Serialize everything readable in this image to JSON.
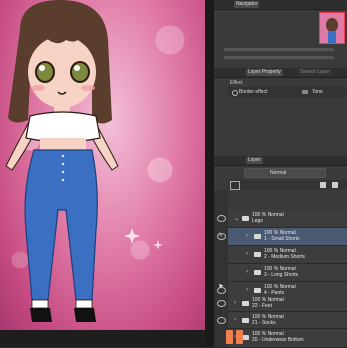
{
  "panel": {
    "navigator_tab": "Navigator",
    "layer_property_tab": "Layer Property",
    "layer_search_tab": "Search Layer",
    "effect_label": "Effect",
    "border_effect_label": "Border effect",
    "tone_label": "Tone",
    "layer_tab": "Layer",
    "blend_mode": "Normal"
  },
  "layers": [
    {
      "line1": "100 % Normal",
      "line2": "Legs"
    },
    {
      "line1": "100 % Normal",
      "line2": "1 - Small Shorts"
    },
    {
      "line1": "100 % Normal",
      "line2": "2 - Medium Shorts"
    },
    {
      "line1": "100 % Normal",
      "line2": "3 - Long Shorts"
    },
    {
      "line1": "100 % Normal",
      "line2": "4 - Pants"
    },
    {
      "line1": "100 % Normal",
      "line2": "22 - Feet"
    },
    {
      "line1": "100 % Normal",
      "line2": "21 - Socks"
    },
    {
      "line1": "100 % Normal",
      "line2": "20 - Underwear Bottom"
    }
  ],
  "colors": {
    "accent": "#f08050",
    "selected_row": "#4a5a72",
    "skin": "#f6d3c4",
    "jeans": "#3a6fc2",
    "hair": "#5a3d2c"
  }
}
